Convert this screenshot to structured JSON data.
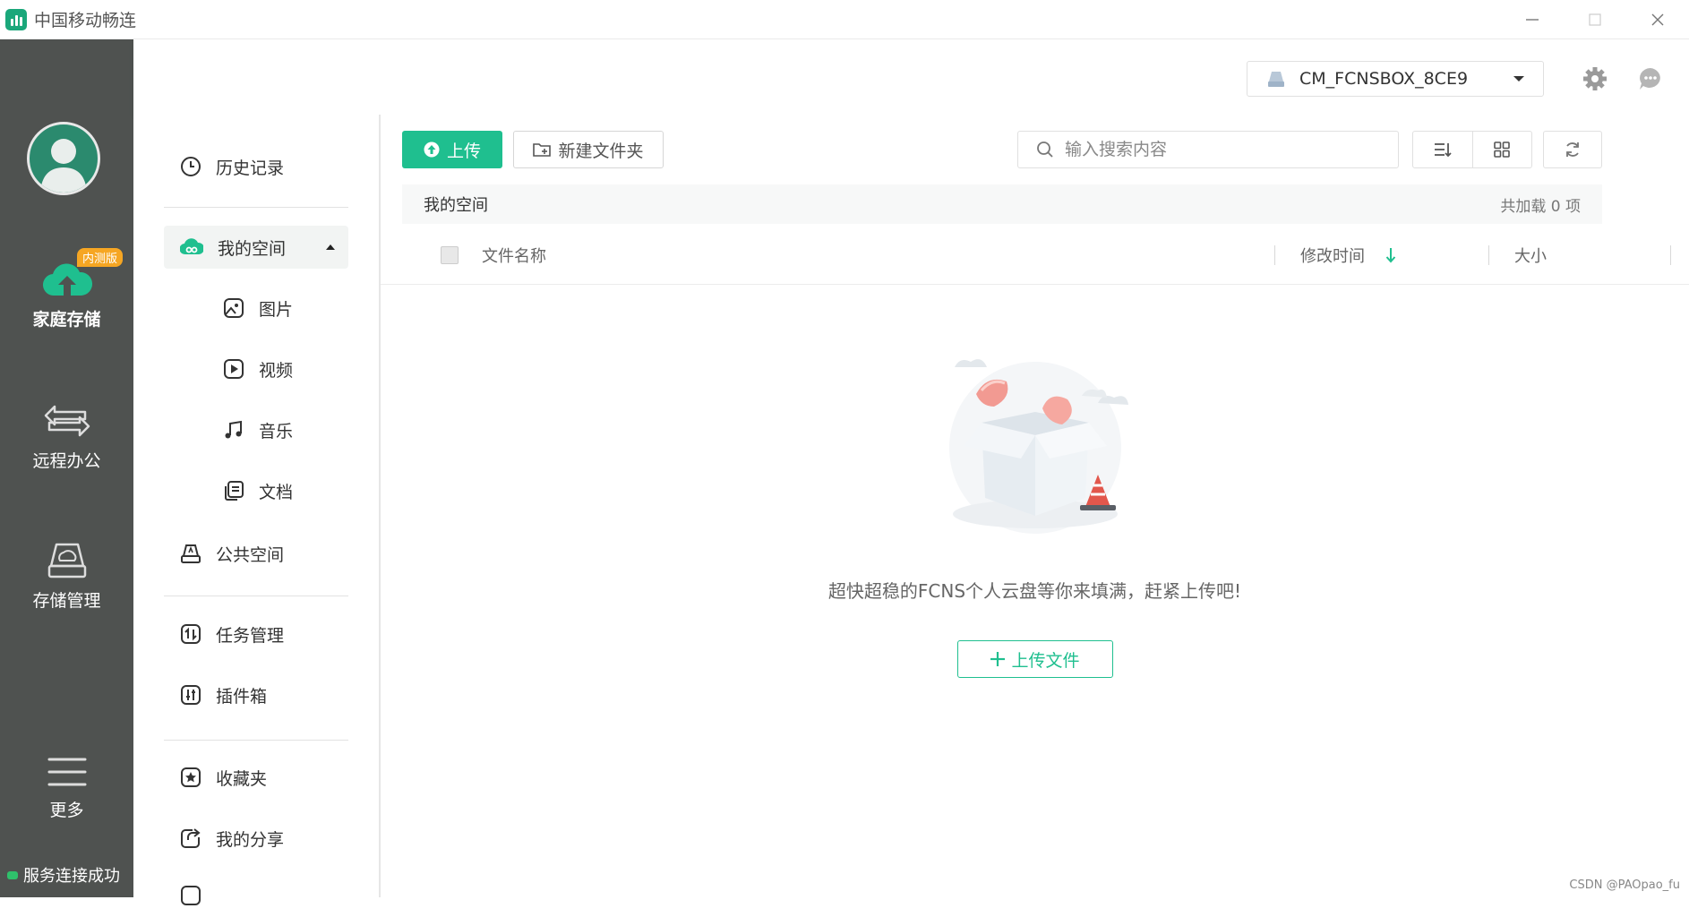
{
  "app": {
    "title": "中国移动畅连"
  },
  "rail": {
    "beta_badge": "内测版",
    "items": [
      {
        "label": "家庭存储",
        "icon": "cloud-upload-icon"
      },
      {
        "label": "远程办公",
        "icon": "transfer-arrows-icon"
      },
      {
        "label": "存储管理",
        "icon": "hard-drive-icon"
      },
      {
        "label": "更多",
        "icon": "menu-icon"
      }
    ],
    "status": "服务连接成功"
  },
  "header": {
    "device": "CM_FCNSBOX_8CE9"
  },
  "nav": {
    "history": "历史记录",
    "my_space": "我的空间",
    "pictures": "图片",
    "videos": "视频",
    "music": "音乐",
    "documents": "文档",
    "public_space": "公共空间",
    "tasks": "任务管理",
    "plugins": "插件箱",
    "favorites": "收藏夹",
    "my_share": "我的分享"
  },
  "toolbar": {
    "upload": "上传",
    "new_folder": "新建文件夹",
    "search_placeholder": "输入搜索内容"
  },
  "breadcrumb": {
    "current": "我的空间",
    "count": "共加载 0 项"
  },
  "table": {
    "col_name": "文件名称",
    "col_modified": "修改时间",
    "col_size": "大小"
  },
  "empty": {
    "message": "超快超稳的FCNS个人云盘等你来填满，赶紧上传吧!",
    "button": "上传文件"
  },
  "watermark": "CSDN @PAOpao_fu",
  "colors": {
    "accent": "#1fbf8f",
    "rail_bg": "#4f5250",
    "badge": "#f6a623"
  }
}
